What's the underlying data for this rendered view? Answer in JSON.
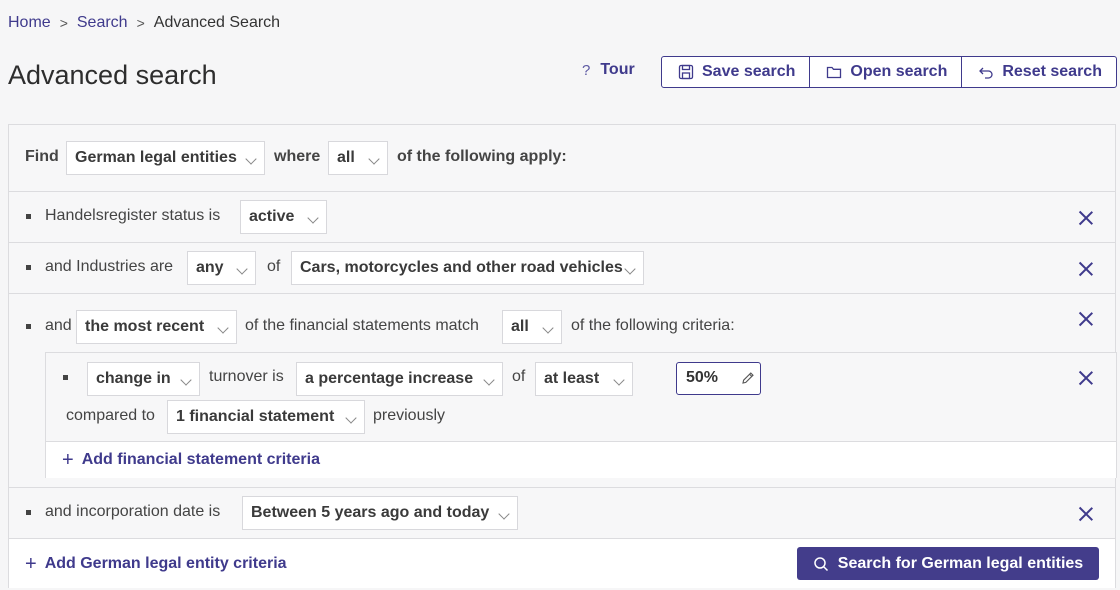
{
  "breadcrumb": {
    "home": "Home",
    "search": "Search",
    "current": "Advanced Search"
  },
  "page_title": "Advanced search",
  "header": {
    "tour": "Tour",
    "save": "Save search",
    "open": "Open search",
    "reset": "Reset search"
  },
  "find": {
    "label": "Find",
    "entity": "German legal entities",
    "where": "where",
    "match": "all",
    "suffix": "of the following apply:"
  },
  "criteria": {
    "status": {
      "label": "Handelsregister status is",
      "value": "active"
    },
    "industries": {
      "label": "and Industries are",
      "quantifier": "any",
      "of": "of",
      "value": "Cars, motorcycles and other road vehicles"
    },
    "financial": {
      "and": "and",
      "which": "the most recent",
      "mid": "of the financial statements match",
      "match": "all",
      "suffix": "of the following criteria:",
      "sub": {
        "mode": "change in",
        "metric": "turnover is",
        "change_type": "a percentage increase",
        "of": "of",
        "bound": "at least",
        "value": "50%",
        "compared": "compared to",
        "period": "1 financial statement",
        "previously": "previously"
      },
      "add_label": "Add financial statement criteria"
    },
    "incorporation": {
      "label": "and incorporation date is",
      "value": "Between 5 years ago and today"
    }
  },
  "footer": {
    "add_label": "Add German legal entity criteria",
    "search_button": "Search for German legal entities"
  },
  "colors": {
    "accent": "#3f3a8c",
    "primary_button": "#433d8b",
    "background": "#f6f6f7"
  }
}
